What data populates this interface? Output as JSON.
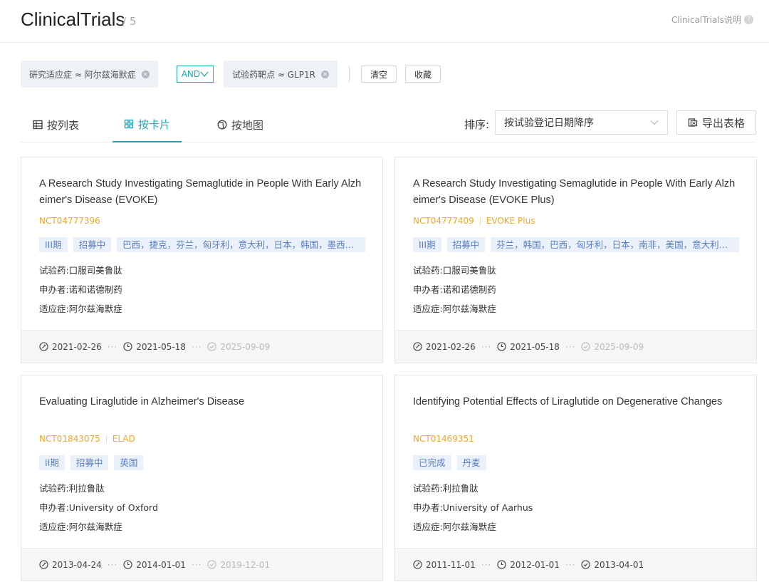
{
  "header": {
    "title": "ClinicalTrials",
    "count": "/ 5",
    "help_link": "ClinicalTrials说明"
  },
  "filters": {
    "chip1": "研究适应症 ≈ 阿尔兹海默症",
    "operator": "AND",
    "chip2": "试验药靶点 ≈ GLP1R",
    "clear_label": "清空",
    "save_label": "收藏"
  },
  "views": {
    "list_label": "按列表",
    "card_label": "按卡片",
    "map_label": "按地图",
    "active": "card"
  },
  "sort": {
    "label": "排序:",
    "value": "按试验登记日期降序",
    "export_label": "导出表格"
  },
  "labels": {
    "drug": "试验药:",
    "sponsor": "申办者:",
    "indication": "适应症:"
  },
  "cards": [
    {
      "title": "A Research Study Investigating Semaglutide in People With Early Alzheimer's Disease (EVOKE)",
      "nct": "NCT04777396",
      "acronym": "",
      "tags": [
        "III期",
        "招募中"
      ],
      "countries": "巴西，捷克，芬兰，匈牙利，意大利，日本，韩国，墨西哥...",
      "drug": "口服司美鲁肽",
      "sponsor": "诺和诺德制药",
      "indication": "阿尔兹海默症",
      "date1": "2021-02-26",
      "date2": "2021-05-18",
      "date3": "2025-09-09",
      "date3_done": false
    },
    {
      "title": "A Research Study Investigating Semaglutide in People With Early Alzheimer's Disease (EVOKE Plus)",
      "nct": "NCT04777409",
      "acronym": "EVOKE Plus",
      "tags": [
        "III期",
        "招募中"
      ],
      "countries": "芬兰，韩国，巴西，匈牙利，日本，南非，美国，意大利，...",
      "drug": "口服司美鲁肽",
      "sponsor": "诺和诺德制药",
      "indication": "阿尔兹海默症",
      "date1": "2021-02-26",
      "date2": "2021-05-18",
      "date3": "2025-09-09",
      "date3_done": false
    },
    {
      "title": "Evaluating Liraglutide in Alzheimer's Disease",
      "nct": "NCT01843075",
      "acronym": "ELAD",
      "tags": [
        "II期",
        "招募中"
      ],
      "countries": "英国",
      "drug": "利拉鲁肽",
      "sponsor": "University of Oxford",
      "indication": "阿尔兹海默症",
      "date1": "2013-04-24",
      "date2": "2014-01-01",
      "date3": "2019-12-01",
      "date3_done": false
    },
    {
      "title": "Identifying Potential Effects of Liraglutide on Degenerative Changes",
      "nct": "NCT01469351",
      "acronym": "",
      "tags": [
        "已完成"
      ],
      "countries": "丹麦",
      "drug": "利拉鲁肽",
      "sponsor": "University of Aarhus",
      "indication": "阿尔兹海默症",
      "date1": "2011-11-01",
      "date2": "2012-01-01",
      "date3": "2013-04-01",
      "date3_done": true
    }
  ]
}
